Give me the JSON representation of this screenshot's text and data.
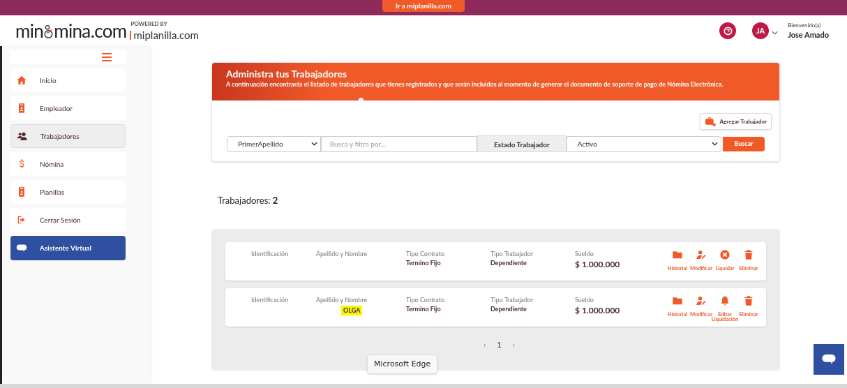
{
  "top_bar": {
    "link": "Ir a miplanilla.com"
  },
  "header": {
    "logo_start": "min",
    "logo_end": "mina.com",
    "powered_by": "POWERED BY",
    "partner": "miplanilla.com",
    "user_initials": "JA",
    "welcome": "Bienvenido(a)",
    "user_name": "Jose Amado"
  },
  "sidebar": {
    "items": [
      {
        "label": "Inicio",
        "kind": "home",
        "selected": false
      },
      {
        "label": "Empleador",
        "kind": "badge",
        "selected": false
      },
      {
        "label": "Trabajadores",
        "kind": "users",
        "selected": true
      },
      {
        "label": "Nómina",
        "kind": "dollar",
        "selected": false
      },
      {
        "label": "Planillas",
        "kind": "badge",
        "selected": false
      },
      {
        "label": "Cerrar Sesión",
        "kind": "logout",
        "selected": false
      }
    ],
    "assistant": "Asistente Virtual"
  },
  "banner": {
    "title": "Administra tus Trabajadores",
    "subtitle": "A continuación encontrarás el listado de trabajadores que tienes registrados y que serán incluídos al momento de generar el documento de soporte de pago de Nómina Electrónica."
  },
  "add_button": "Agregar Trabajador",
  "filters": {
    "field": "PrimerApellido",
    "search_placeholder": "Busca y filtra por...",
    "status_label": "Estado Trabajador",
    "status": "Activo",
    "search_button": "Buscar"
  },
  "count": {
    "label": "Trabajadores:",
    "value": "2"
  },
  "workers": [
    {
      "columns": [
        {
          "label": "Identificación"
        },
        {
          "label": "Apellido y Nombre"
        },
        {
          "label": "Tipo Contrato",
          "value": "Termino Fijo"
        },
        {
          "label": "Tipo Trabajador",
          "value": "Dependiente"
        },
        {
          "label": "Sueldo",
          "value": "$ 1.000.000",
          "kind": "money"
        }
      ],
      "actions": [
        {
          "label": "Historial",
          "kind": "folder"
        },
        {
          "label": "Modificar",
          "kind": "user-edit"
        },
        {
          "label": "Liquidar",
          "kind": "x-circle"
        },
        {
          "label": "Eliminar",
          "kind": "trash"
        }
      ]
    },
    {
      "columns": [
        {
          "label": "Identificación"
        },
        {
          "label": "Apellido y Nombre",
          "value": "OLGA",
          "highlighted": true
        },
        {
          "label": "Tipo Contrato",
          "value": "Termino Fijo"
        },
        {
          "label": "Tipo Trabajador",
          "value": "Dependiente"
        },
        {
          "label": "Sueldo",
          "value": "$ 1.000.000",
          "kind": "money"
        }
      ],
      "actions": [
        {
          "label": "Historial",
          "kind": "folder"
        },
        {
          "label": "Modificar",
          "kind": "user-edit"
        },
        {
          "label": "Editar Liquidación",
          "kind": "bell"
        },
        {
          "label": "Eliminar",
          "kind": "trash"
        }
      ]
    }
  ],
  "pagination": {
    "prev": "‹",
    "page": "1",
    "next": "›"
  },
  "tooltip": "Microsoft Edge"
}
